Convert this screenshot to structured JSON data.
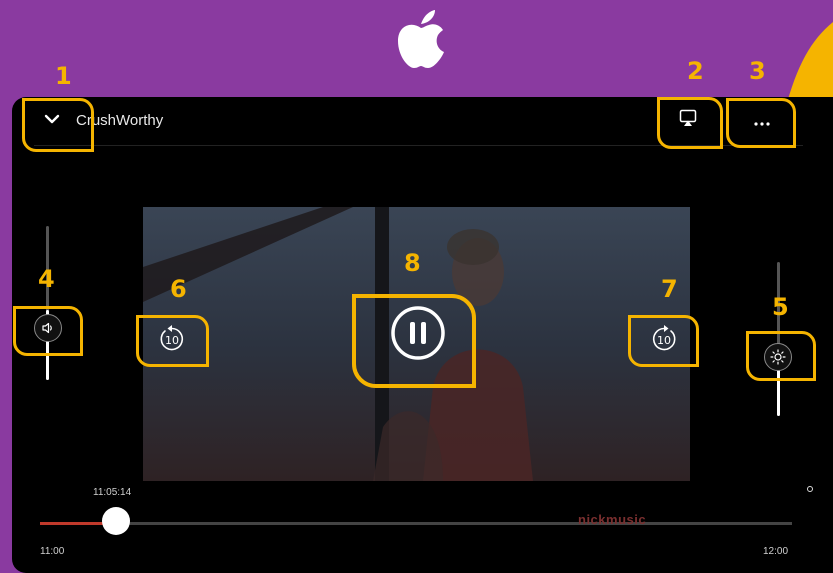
{
  "title": "CrushWorthy",
  "current_time": "11:05:14",
  "start_time": "11:00",
  "end_time": "12:00",
  "watermark": "nickmusic",
  "playback_progress": 0.1,
  "volume_level": 0.45,
  "brightness_level": 0.35,
  "skip_back_label": "10",
  "skip_forward_label": "10",
  "callouts": [
    "1",
    "2",
    "3",
    "4",
    "5",
    "6",
    "7",
    "8"
  ],
  "colors": {
    "background": "#8a3aa0",
    "accent": "#f5b400",
    "progress": "#c0392b"
  },
  "icons": {
    "collapse": "chevron-down-icon",
    "airplay": "airplay-icon",
    "more": "more-icon",
    "volume": "speaker-icon",
    "brightness": "sun-icon",
    "rewind": "rewind-10-icon",
    "forward": "forward-10-icon",
    "pause": "pause-icon"
  }
}
